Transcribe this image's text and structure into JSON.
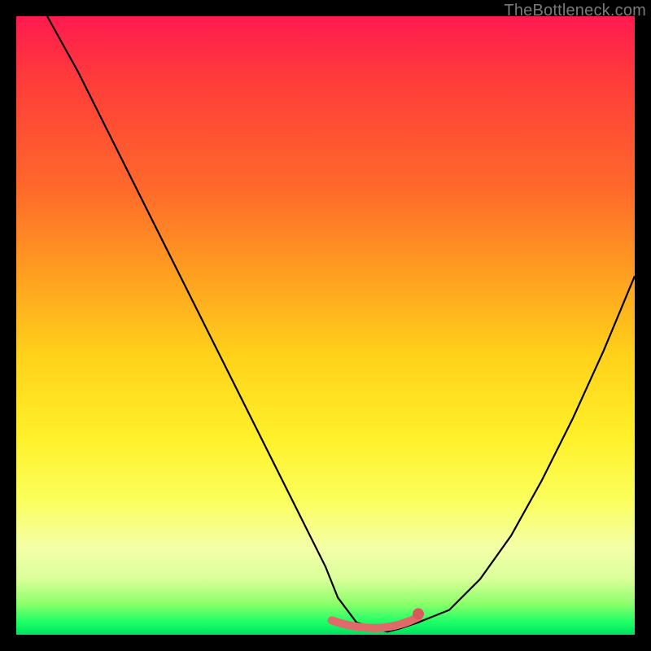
{
  "watermark": "TheBottleneck.com",
  "colors": {
    "background": "#000000",
    "curve": "#000000",
    "highlight_fill": "#e06a6a",
    "highlight_stroke": "#d85a5a"
  },
  "chart_data": {
    "type": "line",
    "title": "",
    "xlabel": "",
    "ylabel": "",
    "xlim": [
      0,
      100
    ],
    "ylim": [
      0,
      100
    ],
    "grid": false,
    "legend": false,
    "note": "V-shaped bottleneck curve; x in percent of axis width, y = bottleneck percentage (0 = no bottleneck at bottom). Values estimated from pixel position.",
    "series": [
      {
        "name": "bottleneck-curve",
        "x": [
          5,
          10,
          15,
          20,
          25,
          30,
          35,
          40,
          45,
          50,
          52,
          55,
          58,
          60,
          62,
          65,
          70,
          75,
          80,
          85,
          90,
          95,
          100
        ],
        "y": [
          100,
          91,
          81,
          71,
          61,
          51,
          41,
          31,
          21,
          11,
          6,
          2,
          1,
          0.5,
          1,
          2,
          4,
          9,
          16,
          25,
          35,
          46,
          58
        ]
      }
    ],
    "highlight_region": {
      "description": "flat/near-zero-bottleneck zone marked in light red along the bottom of the curve",
      "x_start": 51,
      "x_end": 65,
      "y_level": 1
    }
  }
}
